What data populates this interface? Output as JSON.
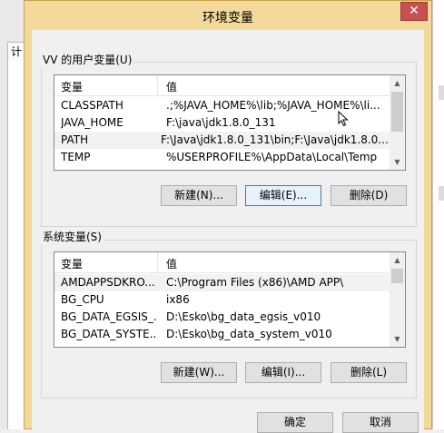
{
  "background": {
    "left_tab_label": "计",
    "right_marks": [
      "(",
      "r"
    ]
  },
  "dialog": {
    "title": "环境变量",
    "close_glyph": "✕",
    "user_section": {
      "label": "VV 的用户变量(U)",
      "columns": [
        "变量",
        "值"
      ],
      "rows": [
        {
          "name": "CLASSPATH",
          "value": ".;%JAVA_HOME%\\lib;%JAVA_HOME%\\li..."
        },
        {
          "name": "JAVA_HOME",
          "value": "F:\\java\\jdk1.8.0_131"
        },
        {
          "name": "PATH",
          "value": " F:\\Java\\jdk1.8.0_131\\bin;F:\\Java\\jdk1.8.0..."
        },
        {
          "name": "TEMP",
          "value": "%USERPROFILE%\\AppData\\Local\\Temp"
        }
      ],
      "buttons": {
        "new": "新建(N)...",
        "edit": "编辑(E)...",
        "delete": "删除(D)"
      }
    },
    "system_section": {
      "label": "系统变量(S)",
      "columns": [
        "变量",
        "值"
      ],
      "rows": [
        {
          "name": "AMDAPPSDKRO...",
          "value": "C:\\Program Files (x86)\\AMD APP\\"
        },
        {
          "name": "BG_CPU",
          "value": "ix86"
        },
        {
          "name": "BG_DATA_EGSIS_...",
          "value": "D:\\Esko\\bg_data_egsis_v010"
        },
        {
          "name": "BG_DATA_SYSTE...",
          "value": "D:\\Esko\\bg_data_system_v010"
        }
      ],
      "buttons": {
        "new": "新建(W)...",
        "edit": "编辑(I)...",
        "delete": "删除(L)"
      }
    },
    "ok_label": "确定",
    "cancel_label": "取消"
  },
  "colors": {
    "titlebar": "#f3d99a",
    "close": "#c75050",
    "focus_border": "#3c7fb1"
  }
}
